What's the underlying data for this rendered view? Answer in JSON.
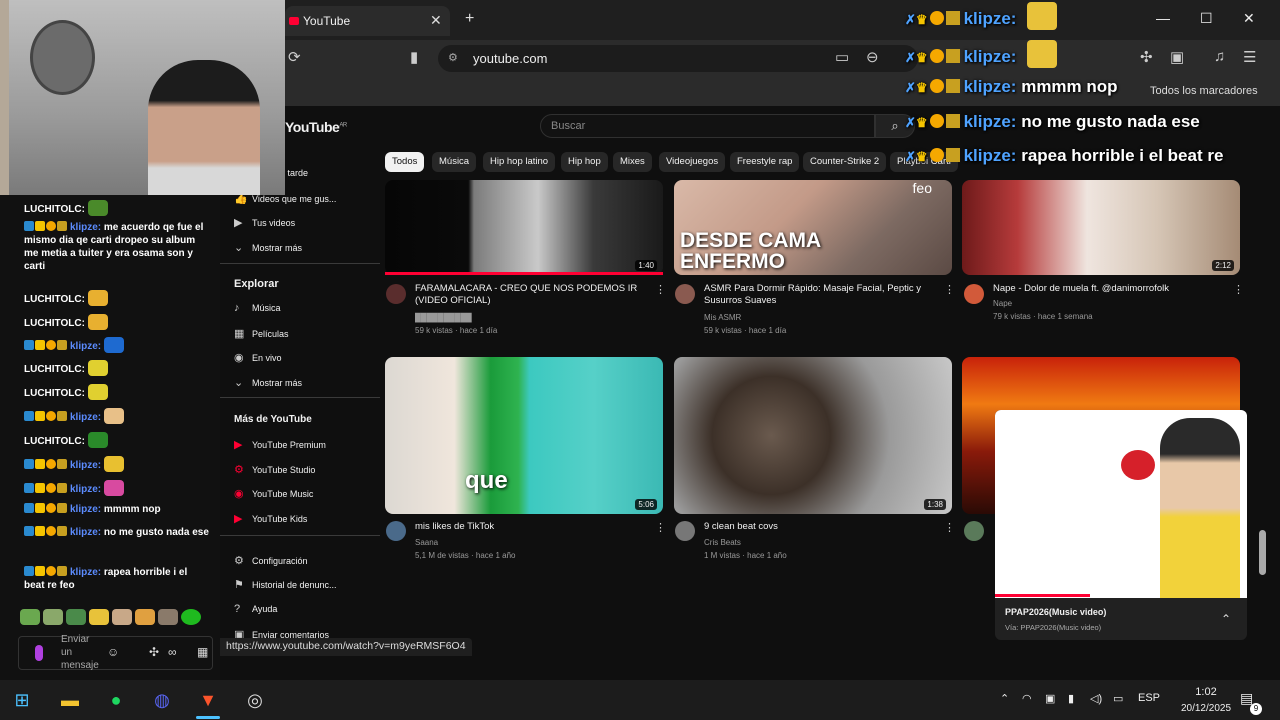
{
  "browser": {
    "tab_title": "YouTube",
    "tab_close": "✕",
    "new_tab": "+",
    "url": "youtube.com",
    "bookmarks_all": "Todos los marcadores",
    "status_url": "https://www.youtube.com/watch?v=m9yeRMSF6O4"
  },
  "youtube": {
    "logo": "YouTube",
    "logo_sup": "AR",
    "search_placeholder": "Buscar",
    "chips": [
      "Todos",
      "Música",
      "Hip hop latino",
      "Hip hop",
      "Mixes",
      "Videojuegos",
      "Freestyle rap",
      "Counter-Strike 2",
      "Playboi Carti"
    ],
    "sidebar": {
      "top_items": [
        {
          "label": "ests",
          "icon": "playlist-icon"
        },
        {
          "label": "Ver más tarde",
          "icon": "clock-icon"
        },
        {
          "label": "Videos que me gus...",
          "icon": "thumb-up-icon"
        },
        {
          "label": "Tus videos",
          "icon": "video-icon"
        },
        {
          "label": "Mostrar más",
          "icon": "chevron-down-icon"
        }
      ],
      "explore_title": "Explorar",
      "explore_items": [
        {
          "label": "Música",
          "icon": "music-note-icon"
        },
        {
          "label": "Películas",
          "icon": "film-icon"
        },
        {
          "label": "En vivo",
          "icon": "live-icon"
        },
        {
          "label": "Mostrar más",
          "icon": "chevron-down-icon"
        }
      ],
      "more_title": "Más de YouTube",
      "more_items": [
        "YouTube Premium",
        "YouTube Studio",
        "YouTube Music",
        "YouTube Kids"
      ],
      "settings_items": [
        "Configuración",
        "Historial de denunc...",
        "Ayuda",
        "Enviar comentarios"
      ]
    },
    "videos": [
      {
        "title": "FARAMALACARA - CREO QUE NOS PODEMOS IR (VIDEO OFICIAL)",
        "channel": "██████████",
        "meta": "59 k vistas · hace 1 día",
        "duration": "1:40",
        "overlay": ""
      },
      {
        "title": "ASMR Para Dormir Rápido: Masaje Facial, Peptic y Susurros Suaves",
        "channel": "Mis ASMR",
        "meta": "59 k vistas · hace 1 día",
        "duration": "",
        "overlay": "DESDE CAMA ENFERMO"
      },
      {
        "title": "Nape - Dolor de muela ft. @danimorrofolk",
        "channel": "Nape",
        "meta": "79 k vistas · hace 1 semana",
        "duration": "2:12",
        "overlay": ""
      },
      {
        "title": "mis likes de TikTok",
        "channel": "Saana",
        "meta": "5,1 M de vistas · hace 1 año",
        "duration": "5:06",
        "overlay": "que"
      },
      {
        "title": "9 clean beat covs",
        "channel": "Cris Beats",
        "meta": "1 M vistas · hace 1 año",
        "duration": "1:38",
        "overlay": ""
      }
    ],
    "miniplayer": {
      "title": "PPAP2026(Music video)",
      "subtitle": "Vía: PPAP2026(Music video)",
      "collapse": "⌃"
    }
  },
  "stream_overlay": {
    "lines": [
      {
        "name": "klipze:",
        "msg": ""
      },
      {
        "name": "klipze:",
        "msg": ""
      },
      {
        "name": "klipze:",
        "msg": "mmmm nop"
      },
      {
        "name": "klipze:",
        "msg": "no me gusto nada ese"
      },
      {
        "name": "klipze:",
        "msg": "rapea horrible i el beat re"
      }
    ],
    "feo": "feo"
  },
  "chat": {
    "messages": [
      {
        "user": "LUCHITOLC:",
        "text": "",
        "badges": false
      },
      {
        "user": "klipze:",
        "text": "me acuerdo qe fue el mismo dia qe carti dropeo su album me metia a tuiter y era osama son y carti",
        "badges": true
      },
      {
        "user": "LUCHITOLC:",
        "text": "",
        "badges": false
      },
      {
        "user": "LUCHITOLC:",
        "text": "",
        "badges": false
      },
      {
        "user": "klipze:",
        "text": "",
        "badges": true
      },
      {
        "user": "LUCHITOLC:",
        "text": "",
        "badges": false
      },
      {
        "user": "LUCHITOLC:",
        "text": "",
        "badges": false
      },
      {
        "user": "klipze:",
        "text": "",
        "badges": true
      },
      {
        "user": "LUCHITOLC:",
        "text": "",
        "badges": false
      },
      {
        "user": "klipze:",
        "text": "",
        "badges": true
      },
      {
        "user": "klipze:",
        "text": "",
        "badges": true
      },
      {
        "user": "klipze:",
        "text": "mmmm nop",
        "badges": true
      },
      {
        "user": "klipze:",
        "text": "no me gusto nada ese",
        "badges": true
      },
      {
        "user": "klipze:",
        "text": "rapea horrible i el beat re feo",
        "badges": true
      }
    ],
    "input_placeholder": "Enviar un mensaje"
  },
  "taskbar": {
    "lang": "ESP",
    "time": "1:02",
    "date": "20/12/2025",
    "notifications": "9"
  }
}
